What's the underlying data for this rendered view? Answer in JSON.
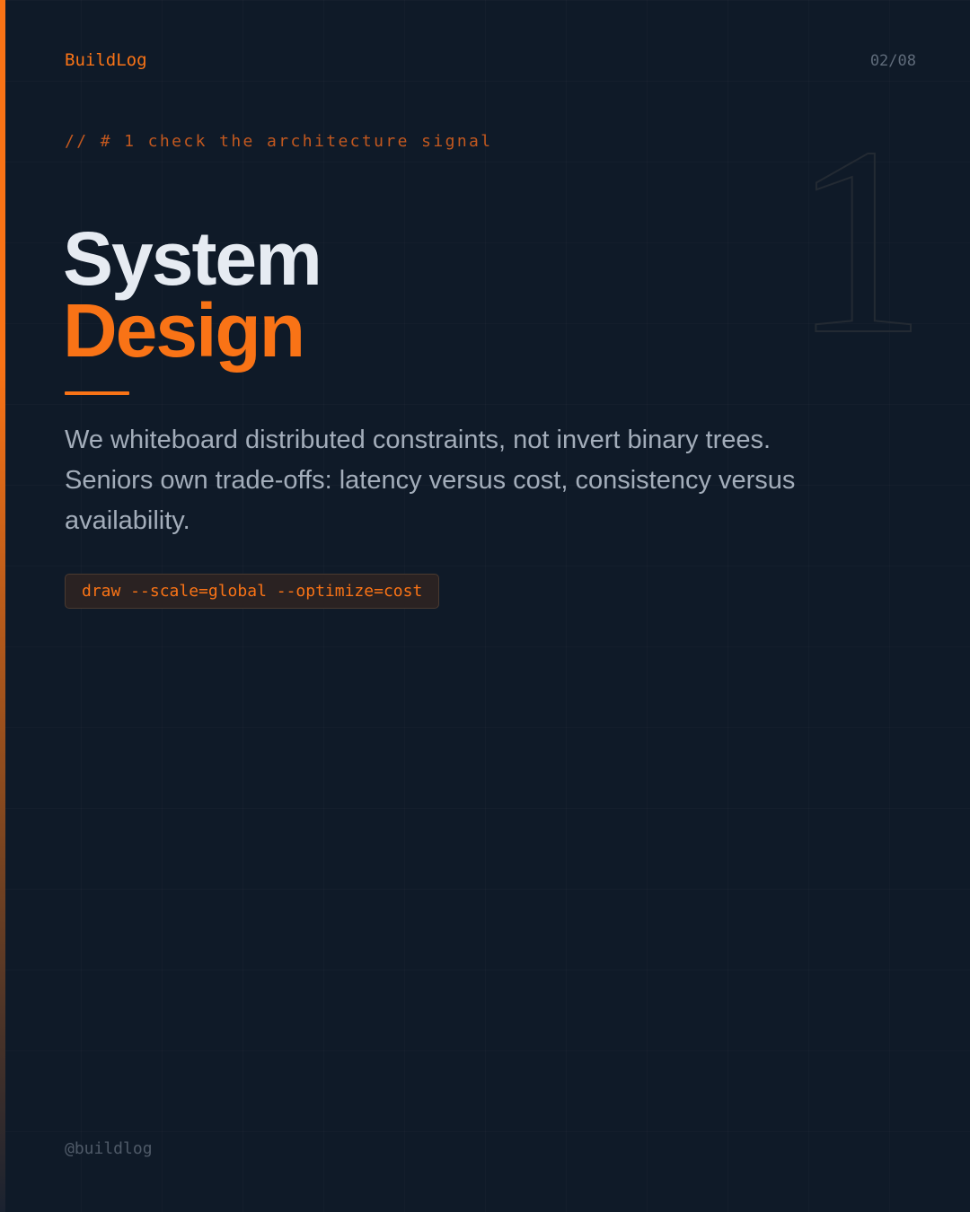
{
  "header": {
    "brand": "BuildLog",
    "page_indicator": "02/08"
  },
  "kicker": "// # 1 check the architecture signal",
  "background_number": "1",
  "title": {
    "line1": "System",
    "line2": "Design"
  },
  "body": "We whiteboard distributed constraints, not invert binary trees. Seniors own trade-offs: latency versus cost, consistency versus availability.",
  "command": "draw --scale=global --optimize=cost",
  "footer": {
    "handle": "@buildlog"
  },
  "colors": {
    "background": "#0f1a28",
    "accent": "#f97316",
    "title": "#e6ebf2",
    "body_text": "#a3adba",
    "muted": "#5f6b7a"
  }
}
